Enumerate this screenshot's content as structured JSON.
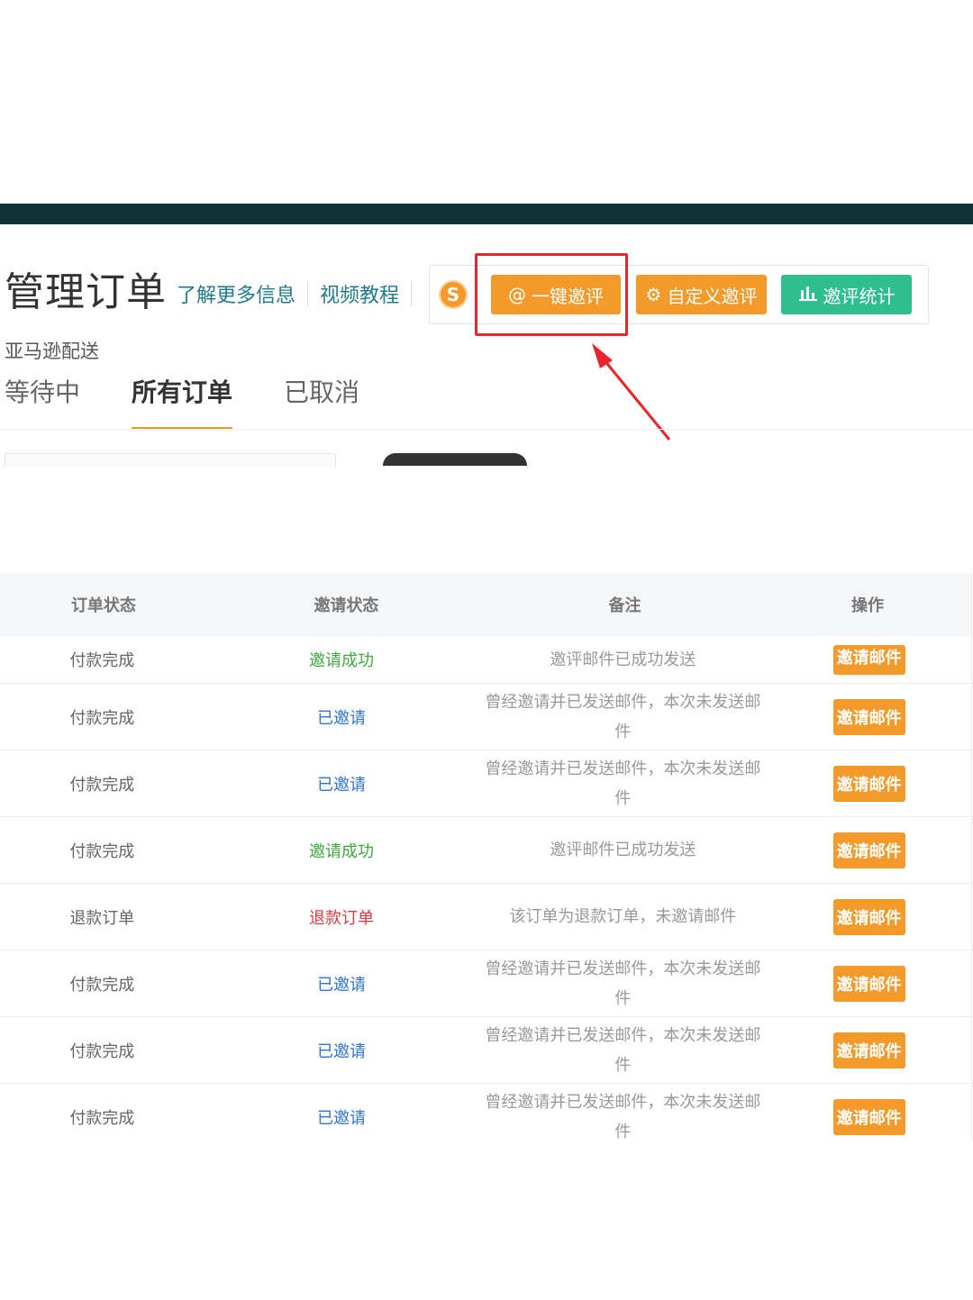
{
  "header": {
    "title": "管理订单",
    "links": [
      "了解更多信息",
      "视频教程"
    ],
    "subtitle": "亚马逊配送"
  },
  "toolbar": {
    "logo_letter": "S",
    "buttons": [
      {
        "label": "一键邀评",
        "icon": "at-icon"
      },
      {
        "label": "自定义邀评",
        "icon": "gear-icon"
      },
      {
        "label": "邀评统计",
        "icon": "bar-chart-icon"
      }
    ]
  },
  "tabs": [
    "等待中",
    "所有订单",
    "已取消"
  ],
  "active_tab": "所有订单",
  "table": {
    "headers": [
      "订单状态",
      "邀请状态",
      "备注",
      "操作"
    ],
    "rows": [
      {
        "order_status": "付款完成",
        "invite_status": "邀请成功",
        "note": "邀评邮件已成功发送",
        "action": "邀请邮件",
        "kind": "success"
      },
      {
        "order_status": "付款完成",
        "invite_status": "已邀请",
        "note": "曾经邀请并已发送邮件，本次未发送邮件",
        "action": "邀请邮件",
        "kind": "invited"
      },
      {
        "order_status": "付款完成",
        "invite_status": "已邀请",
        "note": "曾经邀请并已发送邮件，本次未发送邮件",
        "action": "邀请邮件",
        "kind": "invited"
      },
      {
        "order_status": "付款完成",
        "invite_status": "邀请成功",
        "note": "邀评邮件已成功发送",
        "action": "邀请邮件",
        "kind": "success"
      },
      {
        "order_status": "退款订单",
        "invite_status": "退款订单",
        "note": "该订单为退款订单，未邀请邮件",
        "action": "邀请邮件",
        "kind": "refund"
      },
      {
        "order_status": "付款完成",
        "invite_status": "已邀请",
        "note": "曾经邀请并已发送邮件，本次未发送邮件",
        "action": "邀请邮件",
        "kind": "invited"
      },
      {
        "order_status": "付款完成",
        "invite_status": "已邀请",
        "note": "曾经邀请并已发送邮件，本次未发送邮件",
        "action": "邀请邮件",
        "kind": "invited"
      },
      {
        "order_status": "付款完成",
        "invite_status": "已邀请",
        "note": "曾经邀请并已发送邮件，本次未发送邮件",
        "action": "邀请邮件",
        "kind": "invited"
      }
    ]
  },
  "colors": {
    "accent_orange": "#f39a2b",
    "accent_green": "#2fbf8f",
    "topbar": "#0f3236",
    "highlight_red": "#e8262b",
    "status_success": "#3caa3c",
    "status_invited": "#2f73d6",
    "status_refund": "#e0393e"
  }
}
